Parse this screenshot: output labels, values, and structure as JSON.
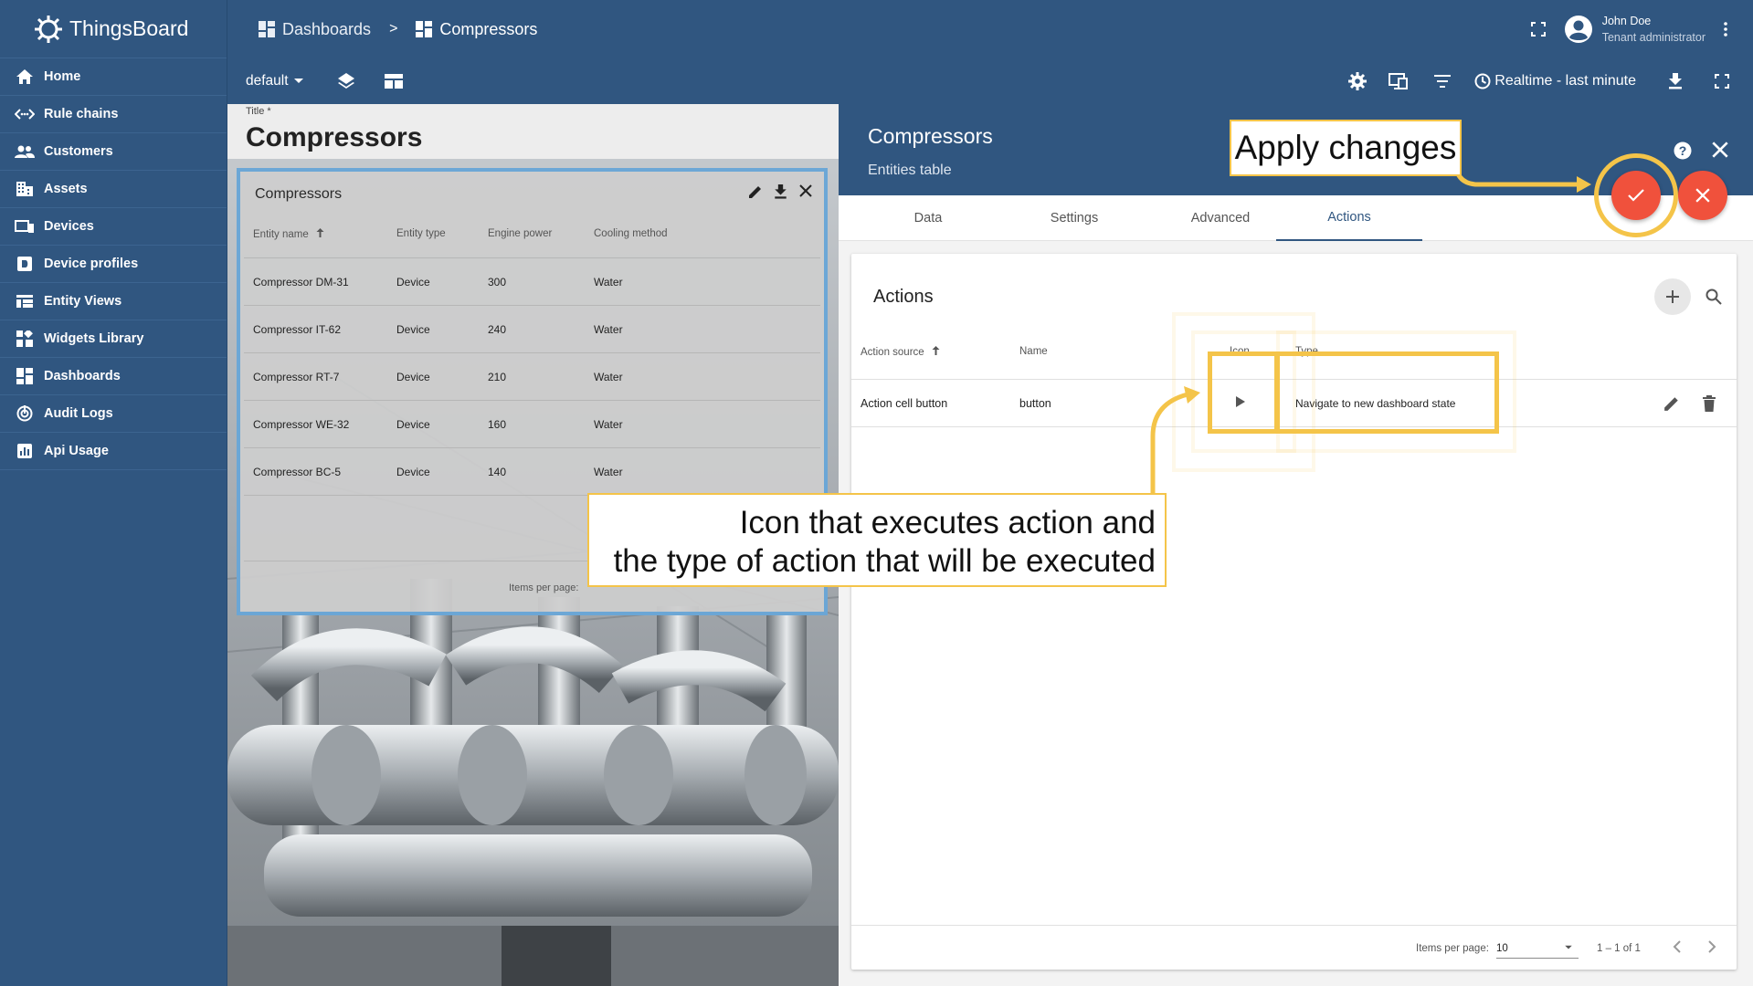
{
  "app": {
    "name": "ThingsBoard"
  },
  "sidebar": {
    "items": [
      {
        "label": "Home",
        "icon": "home-icon"
      },
      {
        "label": "Rule chains",
        "icon": "rule-chain-icon"
      },
      {
        "label": "Customers",
        "icon": "customers-icon"
      },
      {
        "label": "Assets",
        "icon": "assets-icon"
      },
      {
        "label": "Devices",
        "icon": "devices-icon"
      },
      {
        "label": "Device profiles",
        "icon": "device-profile-icon"
      },
      {
        "label": "Entity Views",
        "icon": "entity-views-icon"
      },
      {
        "label": "Widgets Library",
        "icon": "widgets-icon"
      },
      {
        "label": "Dashboards",
        "icon": "dashboards-icon"
      },
      {
        "label": "Audit Logs",
        "icon": "audit-logs-icon"
      },
      {
        "label": "Api Usage",
        "icon": "api-usage-icon"
      }
    ]
  },
  "breadcrumb": {
    "items": [
      "Dashboards",
      "Compressors"
    ],
    "separator": ">"
  },
  "user": {
    "name": "John Doe",
    "role": "Tenant administrator"
  },
  "toolbar": {
    "state": "default",
    "timewindow": "Realtime - last minute"
  },
  "preview": {
    "title_label": "Title *",
    "title_value": "Compressors",
    "widget": {
      "title": "Compressors",
      "columns": [
        "Entity name",
        "Entity type",
        "Engine power",
        "Cooling method"
      ],
      "rows": [
        [
          "Compressor DM-31",
          "Device",
          "300",
          "Water"
        ],
        [
          "Compressor IT-62",
          "Device",
          "240",
          "Water"
        ],
        [
          "Compressor RT-7",
          "Device",
          "210",
          "Water"
        ],
        [
          "Compressor WE-32",
          "Device",
          "160",
          "Water"
        ],
        [
          "Compressor BC-5",
          "Device",
          "140",
          "Water"
        ]
      ],
      "items_per_page_label": "Items per page:"
    }
  },
  "config": {
    "title": "Compressors",
    "subtitle": "Entities table",
    "tabs": [
      "Data",
      "Settings",
      "Advanced",
      "Actions"
    ],
    "active_tab": "Actions",
    "actions": {
      "title": "Actions",
      "columns": [
        "Action source",
        "Name",
        "Icon",
        "Type"
      ],
      "row": {
        "source": "Action cell button",
        "name": "button",
        "icon": "play-arrow-icon",
        "type": "Navigate to new dashboard state"
      },
      "pager": {
        "label": "Items per page:",
        "value": "10",
        "range": "1 – 1 of 1"
      }
    }
  },
  "annotations": {
    "apply": "Apply changes",
    "icon_line1": "Icon that executes action and",
    "icon_line2": "the type of action that will be executed"
  },
  "colors": {
    "primary": "#305680",
    "accent": "#f0513c",
    "highlight": "#f4c449"
  }
}
